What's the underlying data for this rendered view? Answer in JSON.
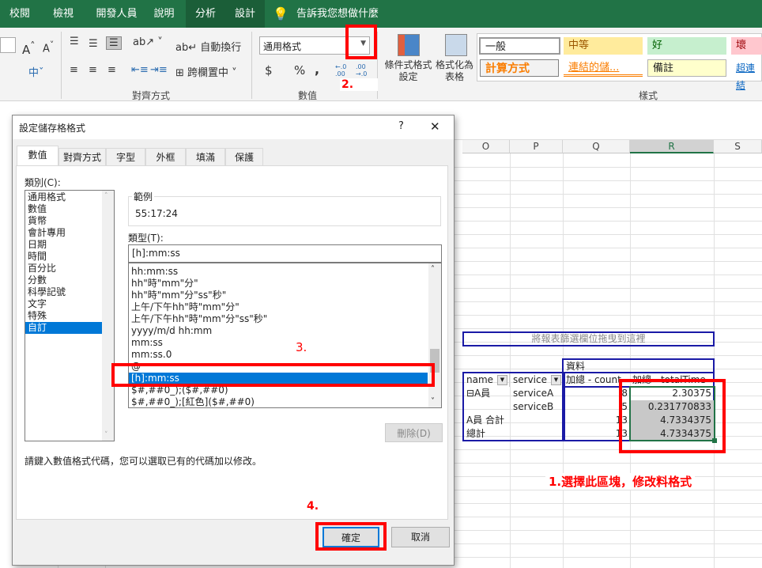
{
  "ribbon_tabs": [
    {
      "label": "校閱"
    },
    {
      "label": "檢視"
    },
    {
      "label": "開發人員"
    },
    {
      "label": "說明"
    },
    {
      "label": "分析"
    },
    {
      "label": "設計"
    }
  ],
  "tell_me": "告訴我您想做什麼",
  "ribbon": {
    "wrap_text": "自動換行",
    "merge_center": "跨欄置中",
    "alignment_group": "對齊方式",
    "number_format": "通用格式",
    "number_group": "數值",
    "currency": "$",
    "percent": "%",
    "comma": ",",
    "inc_decimal": "←.0 .00",
    "dec_decimal": ".00 →.0",
    "conditional_format": "條件式格式設定",
    "format_table": "格式化為表格",
    "styles_group": "樣式",
    "styles": [
      {
        "label": "一般",
        "bg": "#ffffff",
        "color": "#000000"
      },
      {
        "label": "中等",
        "bg": "#ffeb9c",
        "color": "#9c5700"
      },
      {
        "label": "好",
        "bg": "#c6efce",
        "color": "#006100"
      },
      {
        "label": "壞",
        "bg": "#ffc7ce",
        "color": "#9c0006"
      },
      {
        "label": "計算方式",
        "bg": "#f2f2f2",
        "color": "#fa7d00"
      },
      {
        "label": "連結的儲...",
        "bg": "#ffffff",
        "color": "#fa7d00"
      },
      {
        "label": "備註",
        "bg": "#ffffcc",
        "color": "#000000"
      },
      {
        "label": "超連結",
        "bg": "#ffffff",
        "color": "#0563c1"
      }
    ]
  },
  "columns": [
    "O",
    "P",
    "Q",
    "R",
    "S"
  ],
  "pivot": {
    "filter_drop": "將報表篩選欄位拖曳到這裡",
    "data_label": "資料",
    "headers": [
      "name",
      "service",
      "加總 - count",
      "加總 - totalTime"
    ],
    "rows": [
      {
        "name": "⊟A員",
        "service": "serviceA",
        "count": "8",
        "total": "2.30375"
      },
      {
        "name": "",
        "service": "serviceB",
        "count": "5",
        "total": "0.231770833"
      },
      {
        "name": "A員 合計",
        "service": "",
        "count": "13",
        "total": "4.7334375"
      },
      {
        "name": "總計",
        "service": "",
        "count": "13",
        "total": "4.7334375"
      }
    ]
  },
  "annotations": {
    "step1": "1.選擇此區塊，修改料格式",
    "step2": "2.",
    "step3": "3.",
    "step4": "4."
  },
  "dialog": {
    "title": "設定儲存格格式",
    "help": "?",
    "close": "✕",
    "tabs": [
      {
        "label": "數值"
      },
      {
        "label": "對齊方式"
      },
      {
        "label": "字型"
      },
      {
        "label": "外框"
      },
      {
        "label": "填滿"
      },
      {
        "label": "保護"
      }
    ],
    "category_label": "類別(C):",
    "categories": [
      "通用格式",
      "數值",
      "貨幣",
      "會計專用",
      "日期",
      "時間",
      "百分比",
      "分數",
      "科學記號",
      "文字",
      "特殊",
      "自訂"
    ],
    "selected_category": "自訂",
    "sample_label": "範例",
    "sample_value": "55:17:24",
    "type_label": "類型(T):",
    "type_value": "[h]:mm:ss",
    "formats": [
      "hh:mm:ss",
      "hh\"時\"mm\"分\"",
      "hh\"時\"mm\"分\"ss\"秒\"",
      "上午/下午hh\"時\"mm\"分\"",
      "上午/下午hh\"時\"mm\"分\"ss\"秒\"",
      "yyyy/m/d hh:mm",
      "mm:ss",
      "mm:ss.0",
      "@",
      "[h]:mm:ss",
      "$#,##0_);($#,##0)",
      "$#,##0_);[紅色]($#,##0)"
    ],
    "selected_format": "[h]:mm:ss",
    "delete": "刪除(D)",
    "hint": "請鍵入數值格式代碼，您可以選取已有的代碼加以修改。",
    "ok": "確定",
    "cancel": "取消"
  },
  "colors": {
    "excel_green": "#217346",
    "selection_blue": "#0078d7",
    "annotation_red": "#ff0000",
    "pivot_border": "#1a1aa6"
  }
}
